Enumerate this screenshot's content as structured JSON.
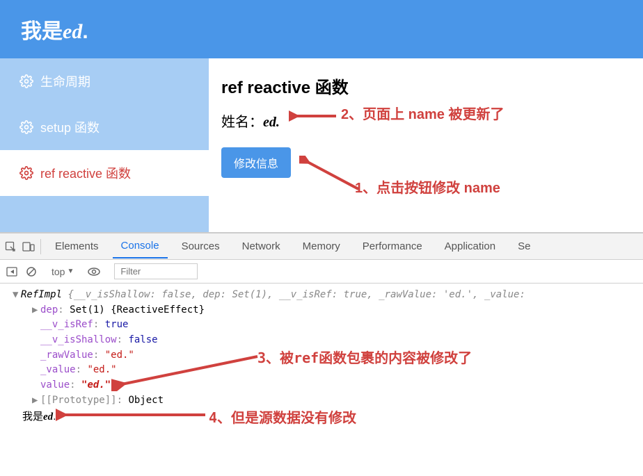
{
  "header": {
    "prefix": "我是",
    "name": "ed",
    "suffix": "."
  },
  "sidebar": {
    "items": [
      {
        "label": "生命周期"
      },
      {
        "label": "setup 函数"
      },
      {
        "label": "ref reactive 函数"
      }
    ]
  },
  "main": {
    "title": "ref reactive 函数",
    "name_label": "姓名：",
    "name_value": "ed.",
    "button": "修改信息"
  },
  "annotations": {
    "a1": "1、点击按钮修改 name",
    "a2": "2、页面上 name 被更新了",
    "a3": "3、被ref函数包裹的内容被修改了",
    "a4": "4、但是源数据没有修改"
  },
  "devtools": {
    "tabs": [
      "Elements",
      "Console",
      "Sources",
      "Network",
      "Memory",
      "Performance",
      "Application",
      "Se"
    ],
    "active_tab": "Console",
    "subbar": {
      "context": "top",
      "filter_placeholder": "Filter"
    }
  },
  "console": {
    "summary_prefix": "RefImpl ",
    "summary_body": "{__v_isShallow: false, dep: Set(1), __v_isRef: true, _rawValue: 'ed.', _value:",
    "lines": {
      "dep": {
        "key": "dep",
        "val": "Set(1) {ReactiveEffect}"
      },
      "isRef": {
        "key": "__v_isRef",
        "val": "true"
      },
      "isShallow": {
        "key": "__v_isShallow",
        "val": "false"
      },
      "rawValue": {
        "key": "_rawValue",
        "val": "\"ed.\""
      },
      "value1": {
        "key": "_value",
        "val": "\"ed.\""
      },
      "value2": {
        "key": "value",
        "val": "\"ed.\""
      },
      "proto": {
        "key": "[[Prototype]]",
        "val": "Object"
      }
    },
    "plain": {
      "prefix": "我是",
      "name": "ed",
      "suffix": "."
    }
  }
}
